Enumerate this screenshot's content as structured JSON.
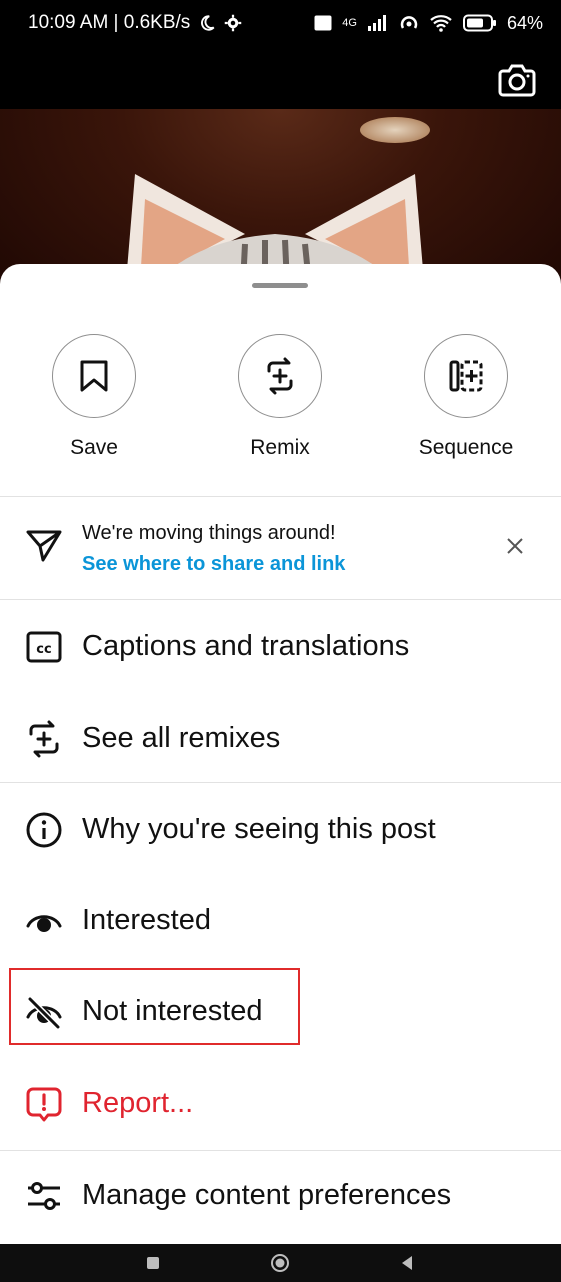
{
  "status_bar": {
    "time_speed": "10:09 AM | 0.6KB/s",
    "network_tags": "4G",
    "battery": "64%"
  },
  "sheet": {
    "actions": [
      {
        "label": "Save",
        "icon": "bookmark-icon"
      },
      {
        "label": "Remix",
        "icon": "remix-icon"
      },
      {
        "label": "Sequence",
        "icon": "sequence-icon"
      }
    ],
    "notice": {
      "title": "We're moving things around!",
      "link": "See where to share and link"
    },
    "menu": [
      {
        "label": "Captions and translations",
        "icon": "cc-icon"
      },
      {
        "label": "See all remixes",
        "icon": "remix-icon"
      },
      {
        "label": "Why you're seeing this post",
        "icon": "info-icon"
      },
      {
        "label": "Interested",
        "icon": "eye-icon"
      },
      {
        "label": "Not interested",
        "icon": "eye-off-icon"
      },
      {
        "label": "Report...",
        "icon": "report-icon"
      },
      {
        "label": "Manage content preferences",
        "icon": "sliders-icon"
      }
    ]
  },
  "colors": {
    "link": "#0b95d8",
    "report": "#e0242f",
    "highlight_border": "#e02b2b"
  }
}
